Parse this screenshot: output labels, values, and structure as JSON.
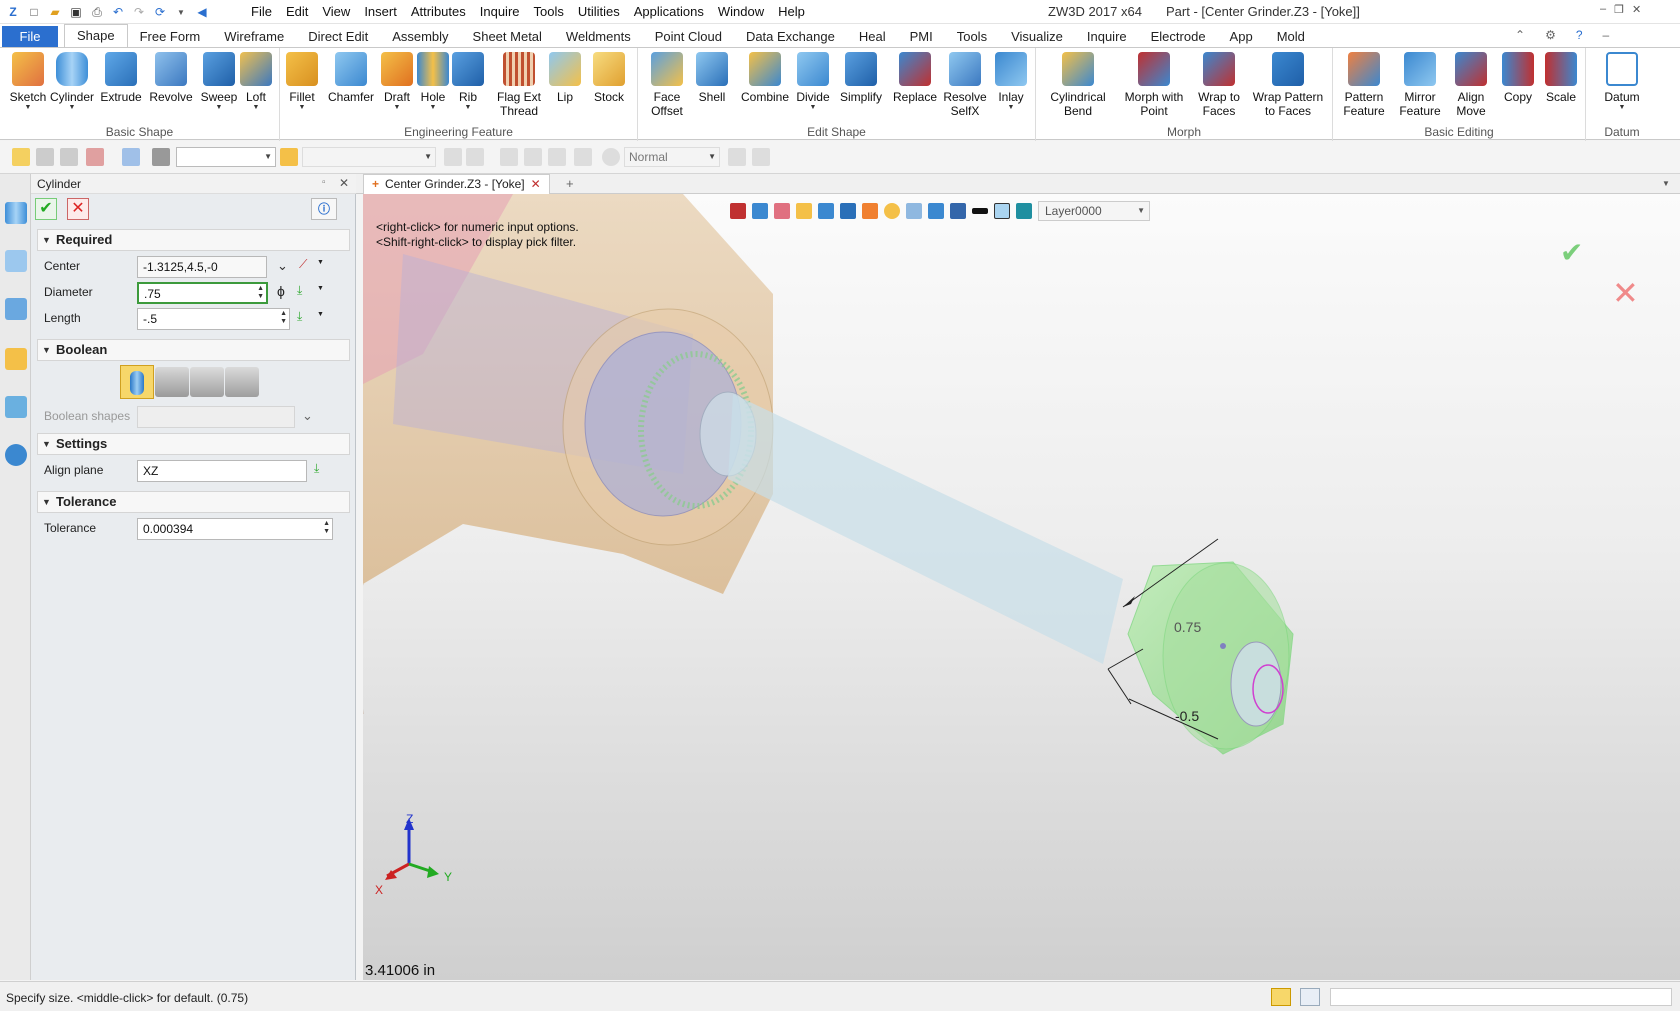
{
  "app": {
    "title": "ZW3D 2017  x64",
    "document": "Part - [Center Grinder.Z3 - [Yoke]]"
  },
  "menu": [
    "File",
    "Edit",
    "View",
    "Insert",
    "Attributes",
    "Inquire",
    "Tools",
    "Utilities",
    "Applications",
    "Window",
    "Help"
  ],
  "ribbon_tabs": [
    "File",
    "Shape",
    "Free Form",
    "Wireframe",
    "Direct Edit",
    "Assembly",
    "Sheet Metal",
    "Weldments",
    "Point Cloud",
    "Data Exchange",
    "Heal",
    "PMI",
    "Tools",
    "Visualize",
    "Inquire",
    "Electrode",
    "App",
    "Mold"
  ],
  "groups": {
    "basic_shape": {
      "label": "Basic Shape",
      "tools": [
        "Sketch",
        "Cylinder",
        "Extrude",
        "Revolve",
        "Sweep",
        "Loft"
      ]
    },
    "engineering": {
      "label": "Engineering Feature",
      "tools": [
        "Fillet",
        "Chamfer",
        "Draft",
        "Hole",
        "Rib",
        "Flag Ext Thread",
        "Lip",
        "Stock"
      ]
    },
    "edit_shape": {
      "label": "Edit Shape",
      "tools": [
        "Face Offset",
        "Shell",
        "Combine",
        "Divide",
        "Simplify",
        "Replace",
        "Resolve SelfX",
        "Inlay"
      ]
    },
    "morph": {
      "label": "Morph",
      "tools": [
        "Cylindrical Bend",
        "Morph with Point",
        "Wrap to Faces",
        "Wrap Pattern to Faces"
      ]
    },
    "basic_editing": {
      "label": "Basic Editing",
      "tools": [
        "Pattern Feature",
        "Mirror Feature",
        "Align Move",
        "Copy",
        "Scale"
      ]
    },
    "datum": {
      "label": "Datum",
      "tools": [
        "Datum"
      ]
    }
  },
  "toolbar2": {
    "render_mode": "Normal"
  },
  "panel": {
    "title": "Cylinder",
    "required": {
      "label": "Required",
      "center_label": "Center",
      "center": "-1.3125,4.5,-0",
      "diameter_label": "Diameter",
      "diameter": ".75",
      "length_label": "Length",
      "length": "-.5"
    },
    "boolean": {
      "label": "Boolean",
      "shapes_label": "Boolean shapes"
    },
    "settings": {
      "label": "Settings",
      "align_label": "Align plane",
      "align": "XZ"
    },
    "tolerance": {
      "label": "Tolerance",
      "tol_label": "Tolerance",
      "tol": "0.000394"
    }
  },
  "viewport": {
    "tab": "Center Grinder.Z3 - [Yoke]",
    "hint1": "<right-click> for numeric input options.",
    "hint2": "<Shift-right-click> to display pick filter.",
    "layer": "Layer0000",
    "dim_diameter": "0.75",
    "dim_length": "-0.5",
    "measure": "3.41006 in",
    "axes": {
      "x": "X",
      "y": "Y",
      "z": "Z"
    }
  },
  "status": "Specify size.  <middle-click> for default. (0.75)"
}
